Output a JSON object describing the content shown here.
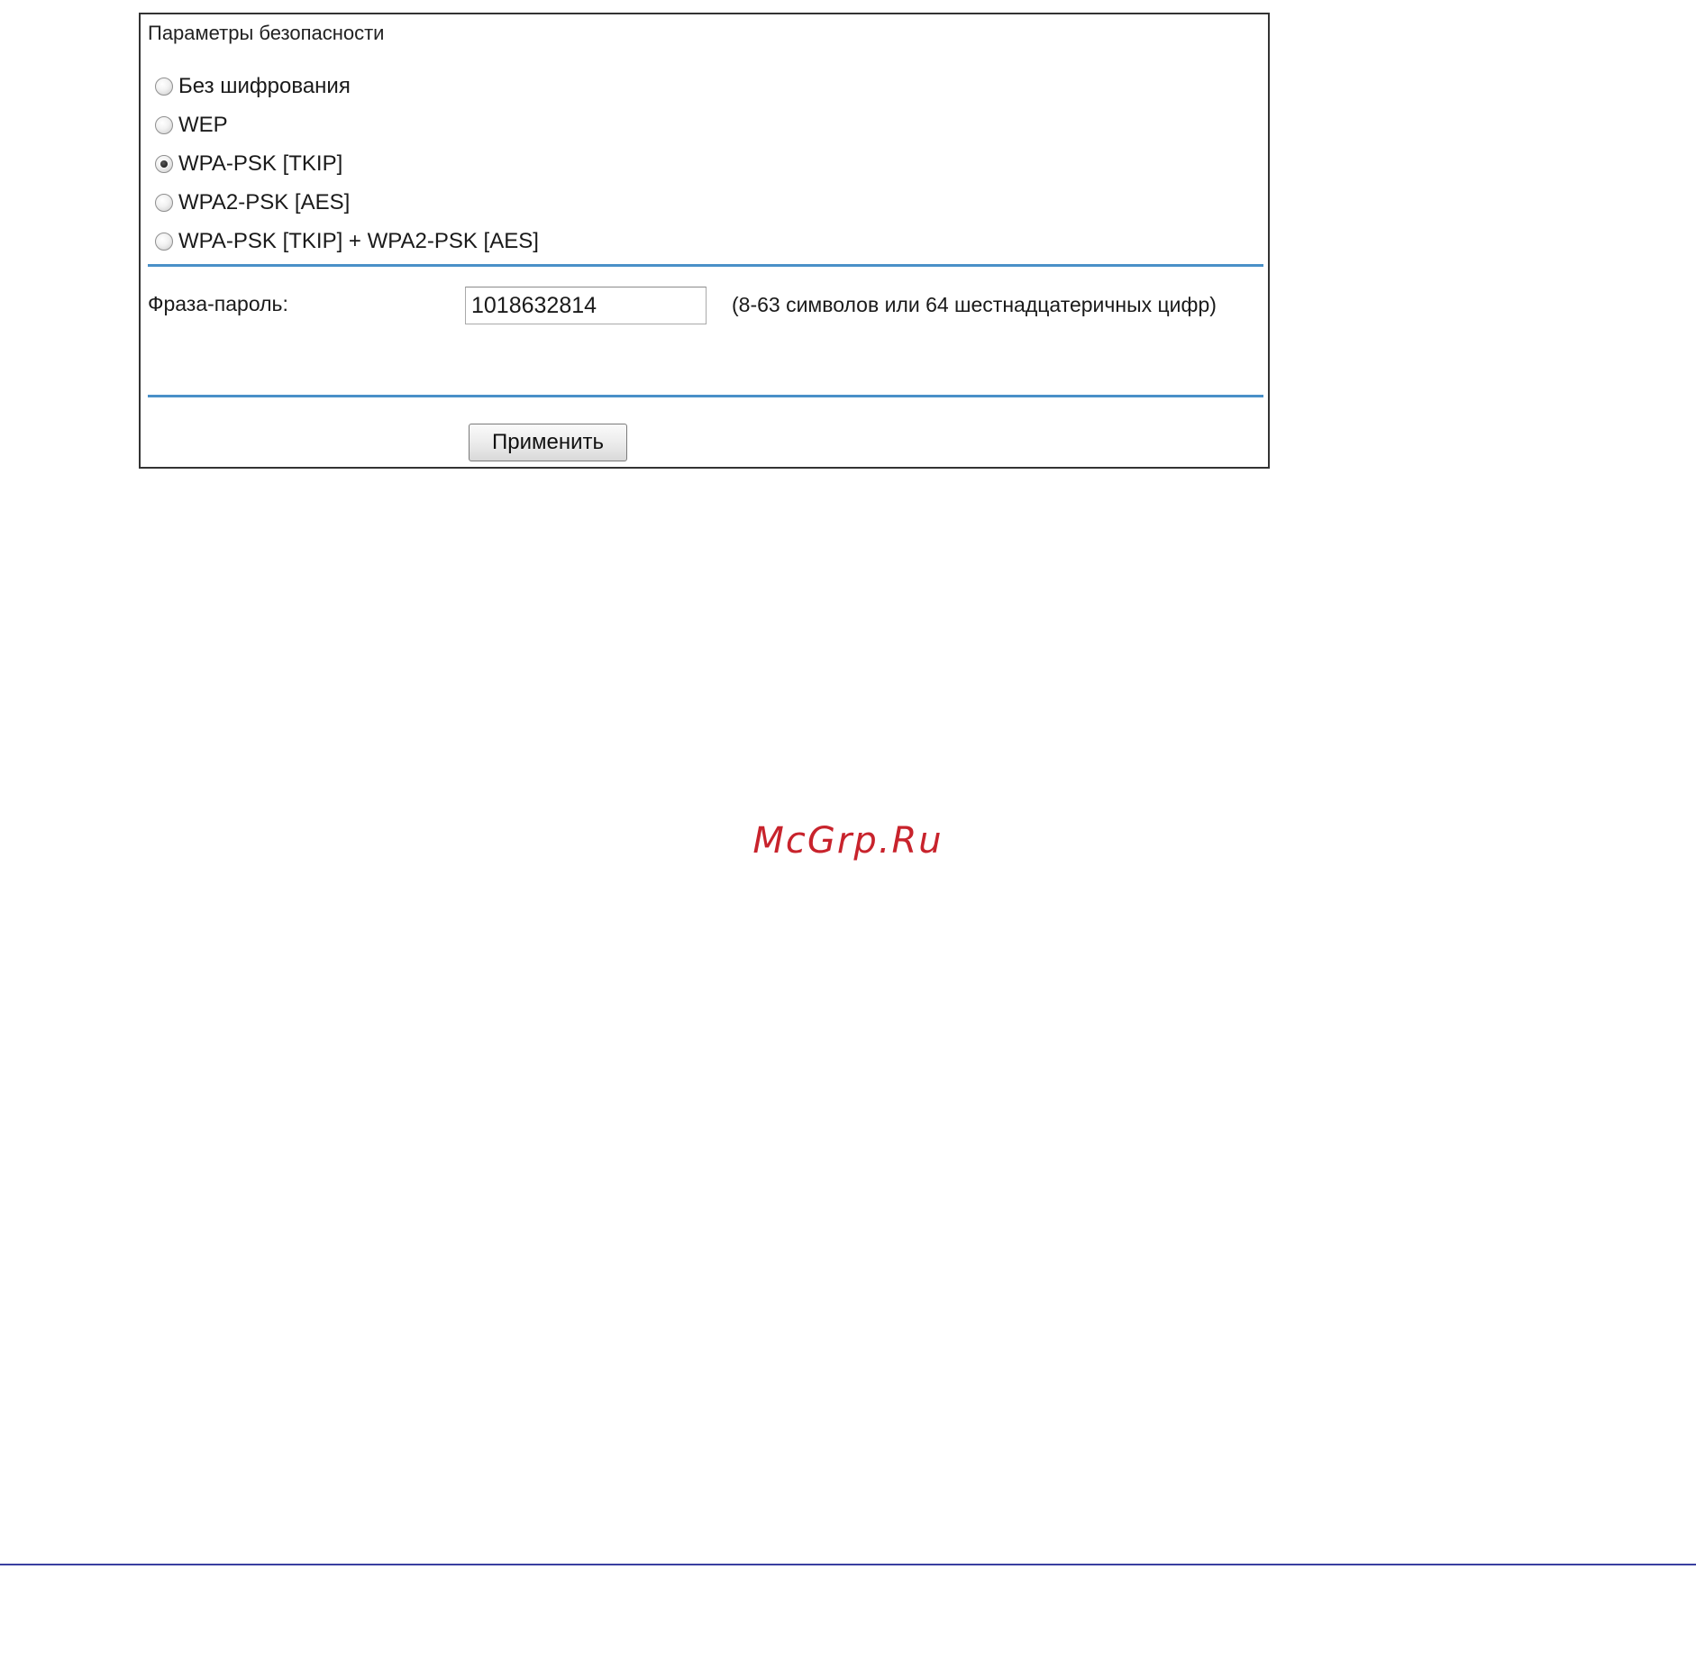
{
  "security": {
    "title": "Параметры безопасности",
    "options": [
      {
        "label": "Без шифрования",
        "checked": false
      },
      {
        "label": "WEP",
        "checked": false
      },
      {
        "label": "WPA-PSK [TKIP]",
        "checked": true
      },
      {
        "label": "WPA2-PSK [AES]",
        "checked": false
      },
      {
        "label": "WPA-PSK [TKIP] + WPA2-PSK [AES]",
        "checked": false
      }
    ]
  },
  "passphrase": {
    "label": "Фраза-пароль:",
    "value": "1018632814",
    "hint": "(8-63 символов или 64 шестнадцатеричных цифр)"
  },
  "apply": {
    "label": "Применить"
  },
  "watermark": {
    "text": "McGrp.Ru"
  },
  "colors": {
    "divider": "#4a90c8",
    "watermark": "#c8232c",
    "footer_rule": "#3a3fa0"
  }
}
